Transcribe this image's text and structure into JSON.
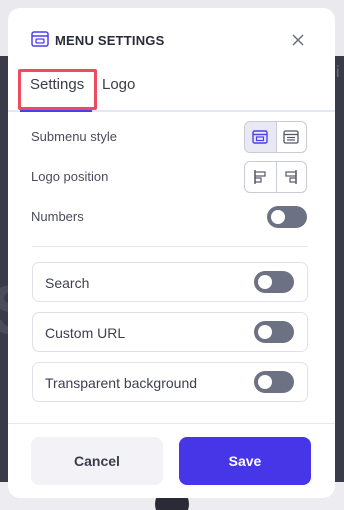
{
  "modal": {
    "title": "MENU SETTINGS",
    "icons": {
      "header": "menu-settings-icon",
      "close": "close-icon"
    }
  },
  "tabs": [
    {
      "label": "Settings",
      "active": true
    },
    {
      "label": "Logo",
      "active": false
    }
  ],
  "settings": {
    "submenu_style": {
      "label": "Submenu style",
      "options": [
        "dropdown-menu-icon",
        "list-menu-icon"
      ],
      "selected": 0
    },
    "logo_position": {
      "label": "Logo position",
      "options": [
        "logo-left-icon",
        "logo-right-icon"
      ],
      "selected": null
    },
    "numbers": {
      "label": "Numbers",
      "enabled": false
    }
  },
  "cards": [
    {
      "label": "Search",
      "enabled": false
    },
    {
      "label": "Custom URL",
      "enabled": false
    },
    {
      "label": "Transparent background",
      "enabled": false
    }
  ],
  "footer": {
    "cancel_label": "Cancel",
    "save_label": "Save"
  },
  "colors": {
    "accent": "#4636e8",
    "highlight": "#ef4b60",
    "toggle_off": "#6c7284",
    "backdrop": "#3a3b48"
  }
}
